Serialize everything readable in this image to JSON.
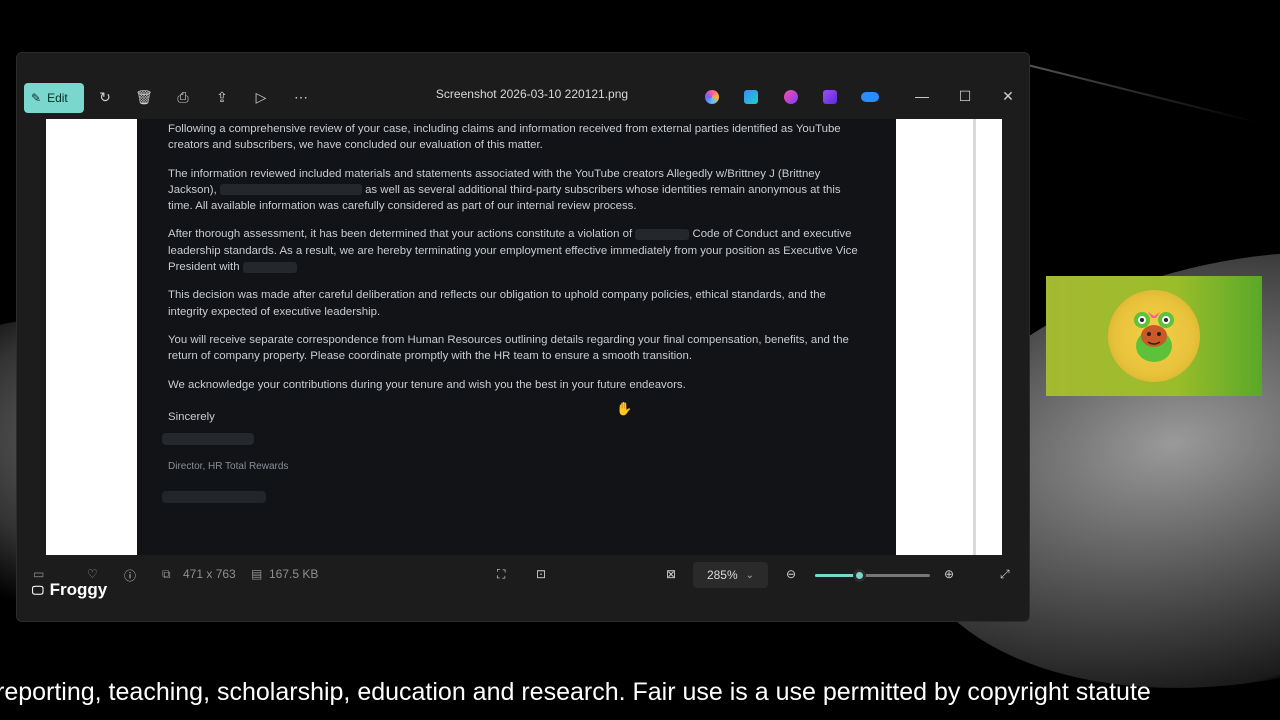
{
  "window": {
    "title": "Screenshot 2026-03-10 220121.png",
    "edit_label": "Edit",
    "toolbar_icons": [
      "rotate-icon",
      "delete-icon",
      "print-icon",
      "share-icon",
      "slideshow-icon",
      "more-icon"
    ],
    "app_icons": [
      "copilot-icon",
      "designer-icon",
      "clipchamp-icon",
      "video-editor-icon",
      "onedrive-icon"
    ],
    "controls": {
      "minimize": "—",
      "maximize": "☐",
      "close": "✕"
    }
  },
  "document": {
    "paragraphs": [
      "Following a comprehensive review of your case, including claims and information received from external parties identified as YouTube creators and subscribers, we have concluded our evaluation of this matter.",
      "The information reviewed included materials and statements associated with the YouTube creators Allegedly w/Brittney J (Brittney Jackson),",
      "as well as several additional third-party subscribers whose identities remain anonymous at this time. All available information was carefully considered as part of our internal review process.",
      "After thorough assessment, it has been determined that your actions constitute a violation of",
      "Code of Conduct and executive leadership standards. As a result, we are hereby terminating your employment effective immediately from your position as Executive Vice President with",
      "This decision was made after careful deliberation and reflects our obligation to uphold company policies, ethical standards, and the integrity expected of executive leadership.",
      "You will receive separate correspondence from Human Resources outlining details regarding your final compensation, benefits, and the return of company property. Please coordinate promptly with the HR team to ensure a smooth transition.",
      "We acknowledge your contributions during your tenure and wish you the best in your future endeavors."
    ],
    "signoff": "Sincerely",
    "signature_title": "Director, HR Total Rewards"
  },
  "statusbar": {
    "dimensions": "471 x 763",
    "file_size": "167.5 KB",
    "zoom": "285%",
    "zoom_slider_fraction": 0.38
  },
  "overlay": {
    "streamer_name": "Froggy",
    "ticker": "reporting, teaching, scholarship, education and research. Fair use is a use permitted by copyright statute"
  },
  "colors": {
    "accent": "#79d7cd",
    "window_bg": "#1c1c1c",
    "doc_bg": "#111316",
    "avatar_green": "#9bbd2a",
    "avatar_gold": "#e8c23a"
  }
}
